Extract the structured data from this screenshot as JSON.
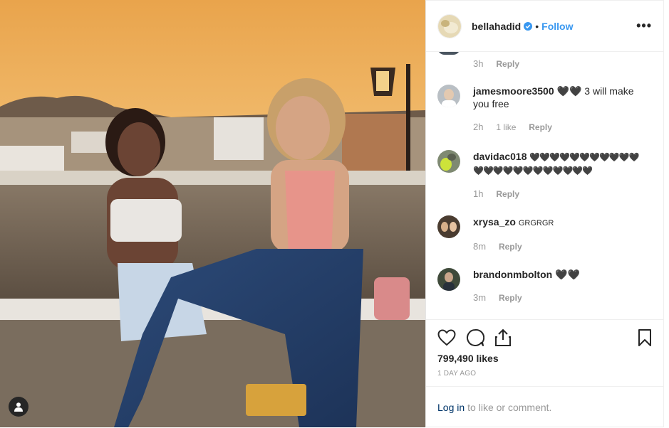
{
  "post": {
    "username": "bellahadid",
    "follow_label": "Follow",
    "dot": "•",
    "more_label": "•••",
    "likes_label": "799,490 likes",
    "timestamp_label": "1 DAY AGO"
  },
  "partial_comment": {
    "time": "3h",
    "reply": "Reply"
  },
  "comments": [
    {
      "user": "jamesmoore3500",
      "text": "🖤🖤 3 will make you free",
      "time": "2h",
      "likes": "1 like",
      "reply": "Reply"
    },
    {
      "user": "davidac018",
      "text": "🖤🖤🖤🖤🖤🖤🖤🖤🖤🖤🖤🖤🖤🖤🖤🖤🖤🖤🖤🖤🖤🖤🖤",
      "time": "1h",
      "reply": "Reply"
    },
    {
      "user": "xrysa_zo",
      "text": "GRGRGR",
      "time": "8m",
      "reply": "Reply"
    },
    {
      "user": "brandonmbolton",
      "text": "🖤🖤",
      "time": "3m",
      "reply": "Reply"
    }
  ],
  "footer": {
    "login": "Log in",
    "rest": "to like or comment."
  },
  "icons": {
    "like": "heart-icon",
    "comment": "comment-icon",
    "share": "share-icon",
    "save": "bookmark-icon",
    "tag": "user-tag-icon"
  },
  "colors": {
    "link": "#3897f0",
    "login": "#003569",
    "verified": "#3897f0"
  }
}
